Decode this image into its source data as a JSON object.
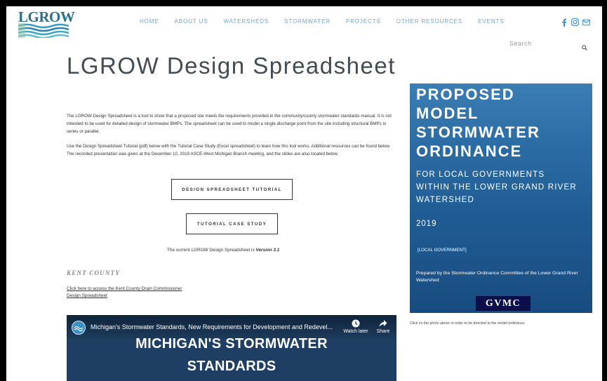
{
  "header": {
    "logo_text": "LGROW",
    "nav": [
      "HOME",
      "ABOUT US",
      "WATERSHEDS",
      "STORMWATER",
      "PROJECTS",
      "OTHER RESOURCES",
      "EVENTS"
    ],
    "search_placeholder": "Search"
  },
  "main": {
    "title": "LGROW Design Spreadsheet",
    "para1": "The LGROW Design Spreadsheet is a tool to show that a proposed site meets the requirements provided in the community/county stormwater standards manual. It is not intended to be used for detailed design of stormwater BMPs. The spreadsheet can be used to model a single discharge point from the site including structural BMPs in series or parallel.",
    "para2": "Use the Design Spreadsheet Tutorial (pdf) below with the Tutorial Case Study (Excel spreadsheet) to learn how this tool works. Additional resources can be found below. The recorded presentation was given at the December 10, 2019 ASCE-West Michigan Branch meeting, and the slides are also located below.",
    "btn_tutorial": "DESIGN SPREADSHEET TUTORIAL",
    "btn_case": "TUTORIAL CASE STUDY",
    "version_prefix": "The current LGROW Design Spreadsheet is ",
    "version_value": "Version 3.1",
    "county_heading": "KENT COUNTY",
    "kent_link": "Click here to access the Kent County Drain Commissioner Design Spreadsheet"
  },
  "video": {
    "title": "Michigan's Stormwater Standards, New Requirements for Development and Redevel...",
    "watch_later": "Watch later",
    "share": "Share",
    "headline1": "MICHIGAN'S STORMWATER",
    "headline2": "STANDARDS"
  },
  "ordinance": {
    "line1": "PROPOSED",
    "line2": "MODEL",
    "line3": "STORMWATER",
    "line4": "ORDINANCE",
    "sub1": "FOR LOCAL GOVERNMENTS",
    "sub2": "WITHIN THE LOWER GRAND RIVER",
    "sub3": "WATERSHED",
    "year": "2019",
    "local": "[LOCAL GOVERNMENT]",
    "prepared": "Prepared by the Stormwater Ordinance Committee of the Lower Grand River Watershed",
    "gvmc": "GVMC",
    "caption": "Click on the photo above in order to be directed to the model ordinance."
  },
  "colors": {
    "nav": "#6fa6cf",
    "title": "#424c55",
    "ordinance_blue": "#2a6aa2",
    "gvmc_navy": "#0b0f4a"
  },
  "icons": [
    "facebook-icon",
    "instagram-icon",
    "email-icon",
    "search-icon",
    "clock-icon",
    "share-arrow-icon"
  ]
}
